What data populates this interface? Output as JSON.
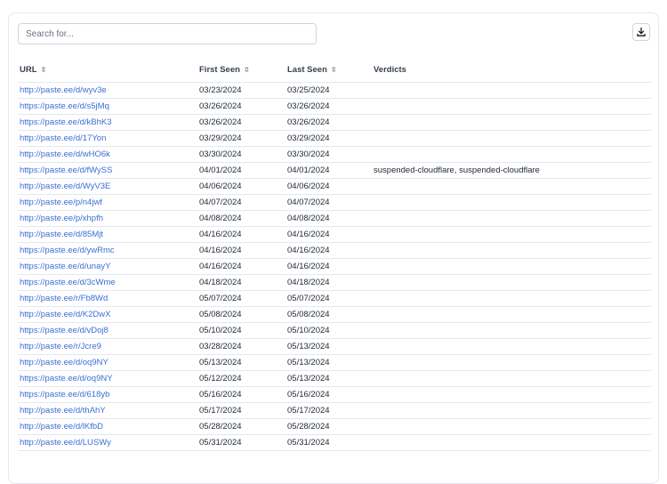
{
  "search": {
    "placeholder": "Search for..."
  },
  "download_icon": "download-icon",
  "columns": {
    "url": "URL",
    "first_seen": "First Seen",
    "last_seen": "Last Seen",
    "verdicts": "Verdicts",
    "sort_glyph": "⇳"
  },
  "rows": [
    {
      "url": "http://paste.ee/d/wyv3e",
      "first": "03/23/2024",
      "last": "03/25/2024",
      "verdicts": ""
    },
    {
      "url": "https://paste.ee/d/s5jMq",
      "first": "03/26/2024",
      "last": "03/26/2024",
      "verdicts": ""
    },
    {
      "url": "https://paste.ee/d/kBhK3",
      "first": "03/26/2024",
      "last": "03/26/2024",
      "verdicts": ""
    },
    {
      "url": "http://paste.ee/d/17Yon",
      "first": "03/29/2024",
      "last": "03/29/2024",
      "verdicts": ""
    },
    {
      "url": "http://paste.ee/d/wHO6k",
      "first": "03/30/2024",
      "last": "03/30/2024",
      "verdicts": ""
    },
    {
      "url": "https://paste.ee/d/fWySS",
      "first": "04/01/2024",
      "last": "04/01/2024",
      "verdicts": "suspended-cloudflare, suspended-cloudflare"
    },
    {
      "url": "http://paste.ee/d/WyV3E",
      "first": "04/06/2024",
      "last": "04/06/2024",
      "verdicts": ""
    },
    {
      "url": "http://paste.ee/p/n4jwf",
      "first": "04/07/2024",
      "last": "04/07/2024",
      "verdicts": ""
    },
    {
      "url": "http://paste.ee/p/xhpfh",
      "first": "04/08/2024",
      "last": "04/08/2024",
      "verdicts": ""
    },
    {
      "url": "http://paste.ee/d/85Mjt",
      "first": "04/16/2024",
      "last": "04/16/2024",
      "verdicts": ""
    },
    {
      "url": "https://paste.ee/d/ywRmc",
      "first": "04/16/2024",
      "last": "04/16/2024",
      "verdicts": ""
    },
    {
      "url": "https://paste.ee/d/unayY",
      "first": "04/16/2024",
      "last": "04/16/2024",
      "verdicts": ""
    },
    {
      "url": "https://paste.ee/d/3cWme",
      "first": "04/18/2024",
      "last": "04/18/2024",
      "verdicts": ""
    },
    {
      "url": "http://paste.ee/r/Fb8Wd",
      "first": "05/07/2024",
      "last": "05/07/2024",
      "verdicts": ""
    },
    {
      "url": "http://paste.ee/d/K2DwX",
      "first": "05/08/2024",
      "last": "05/08/2024",
      "verdicts": ""
    },
    {
      "url": "https://paste.ee/d/vDoj8",
      "first": "05/10/2024",
      "last": "05/10/2024",
      "verdicts": ""
    },
    {
      "url": "http://paste.ee/r/Jcre9",
      "first": "03/28/2024",
      "last": "05/13/2024",
      "verdicts": ""
    },
    {
      "url": "http://paste.ee/d/oq9NY",
      "first": "05/13/2024",
      "last": "05/13/2024",
      "verdicts": ""
    },
    {
      "url": "https://paste.ee/d/oq9NY",
      "first": "05/12/2024",
      "last": "05/13/2024",
      "verdicts": ""
    },
    {
      "url": "https://paste.ee/d/618yb",
      "first": "05/16/2024",
      "last": "05/16/2024",
      "verdicts": ""
    },
    {
      "url": "http://paste.ee/d/thAhY",
      "first": "05/17/2024",
      "last": "05/17/2024",
      "verdicts": ""
    },
    {
      "url": "http://paste.ee/d/lKfbD",
      "first": "05/28/2024",
      "last": "05/28/2024",
      "verdicts": ""
    },
    {
      "url": "http://paste.ee/d/LUSWy",
      "first": "05/31/2024",
      "last": "05/31/2024",
      "verdicts": ""
    }
  ]
}
